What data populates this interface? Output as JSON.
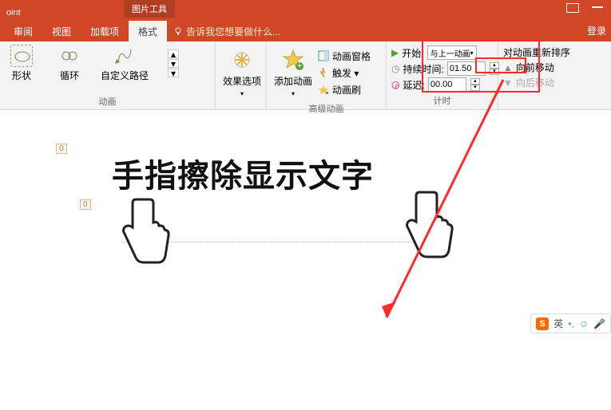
{
  "app_name": "oint",
  "ctx_tab": "图片工具",
  "tabs": {
    "review": "审阅",
    "view": "视图",
    "addins": "加载项",
    "format": "格式"
  },
  "tellme": "告诉我您想要做什么...",
  "login": "登录",
  "ribbon": {
    "anim_group": "动画",
    "items": {
      "shape": "形状",
      "loop": "循环",
      "custom_path": "自定义路径"
    },
    "effect_options": "效果选项",
    "advanced": {
      "group": "高级动画",
      "add": "添加动画",
      "pane": "动画窗格",
      "trigger": "触发 ▾",
      "painter": "动画刷"
    },
    "timing": {
      "group": "计时",
      "start_label": "开始:",
      "start_value": "与上一动画...",
      "duration_label": "持续时间:",
      "duration_value": "01.50",
      "delay_label": "延迟:",
      "delay_value": "00.00",
      "reorder": "对动画重新排序",
      "move_up": "向前移动",
      "move_down": "向后移动"
    }
  },
  "slide": {
    "tag0": "0",
    "tag1": "0",
    "headline": "手指擦除显示文字"
  },
  "ime": {
    "lang": "英",
    "comma": "•,",
    "smile": "☺",
    "mic": "🎤"
  }
}
